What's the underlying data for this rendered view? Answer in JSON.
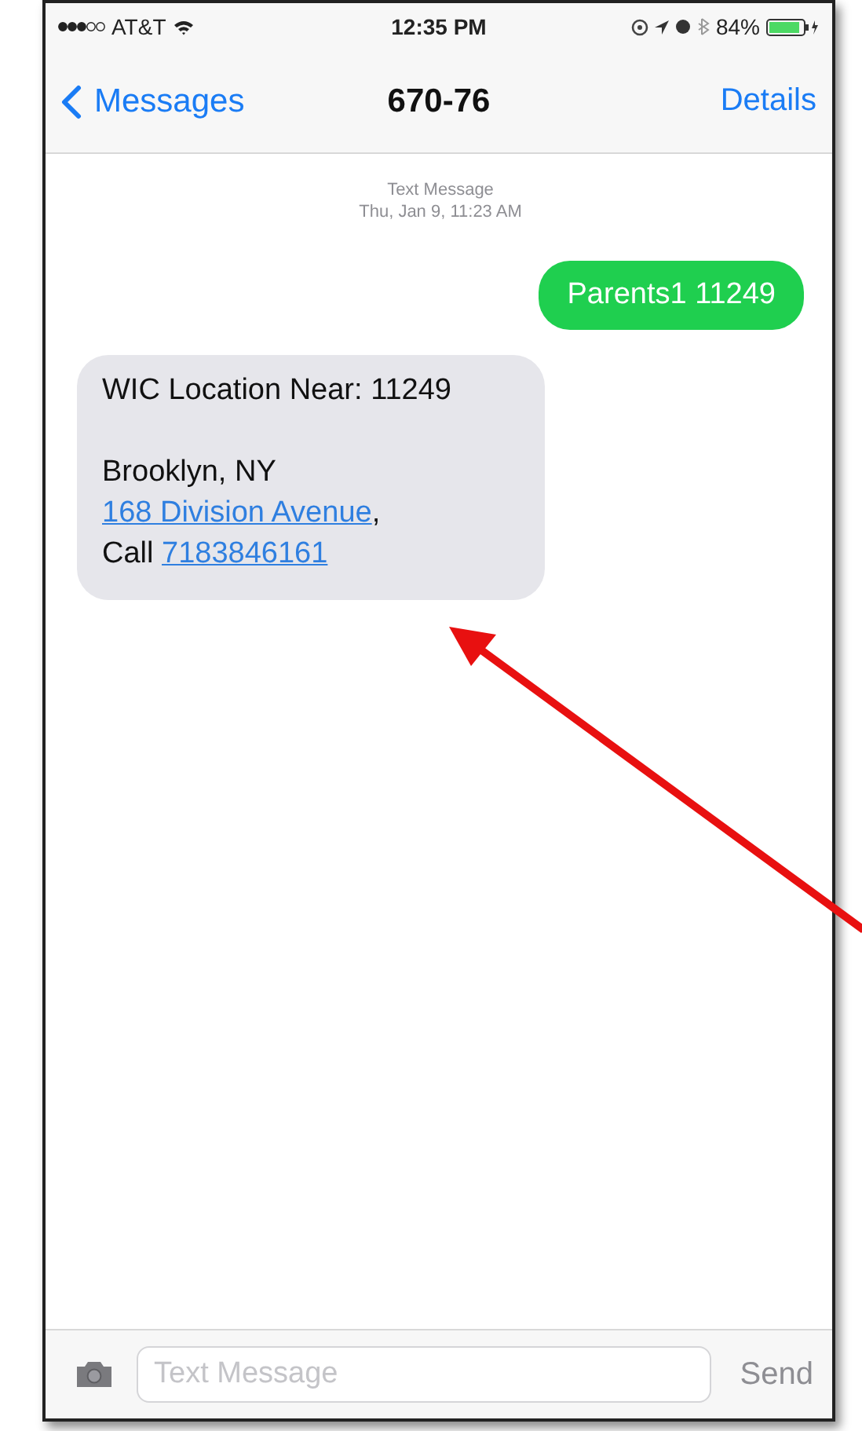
{
  "status_bar": {
    "carrier": "AT&T",
    "time": "12:35 PM",
    "battery": "84%"
  },
  "nav_bar": {
    "back": "Messages",
    "title": "670-76",
    "action": "Details"
  },
  "timestamp": {
    "label": "Text Message",
    "time": "Thu, Jan 9, 11:23 AM"
  },
  "messages": [
    {
      "kind": "sent",
      "paragraphs": [
        [
          [
            {
              "kind": "text",
              "text": "Parents1 11249"
            }
          ]
        ]
      ]
    },
    {
      "kind": "received",
      "paragraphs": [
        [
          [
            {
              "kind": "text",
              "text": "WIC Location Near: 11249"
            }
          ]
        ],
        [
          [
            {
              "kind": "text",
              "text": "Brooklyn, NY"
            }
          ],
          [
            {
              "kind": "link",
              "text": "168 Division Avenue"
            },
            {
              "kind": "text",
              "text": ","
            }
          ],
          [
            {
              "kind": "text",
              "text": "Call "
            },
            {
              "kind": "link",
              "text": "7183846161"
            }
          ]
        ]
      ]
    }
  ],
  "composer": {
    "placeholder": "Text Message",
    "send": "Send"
  }
}
